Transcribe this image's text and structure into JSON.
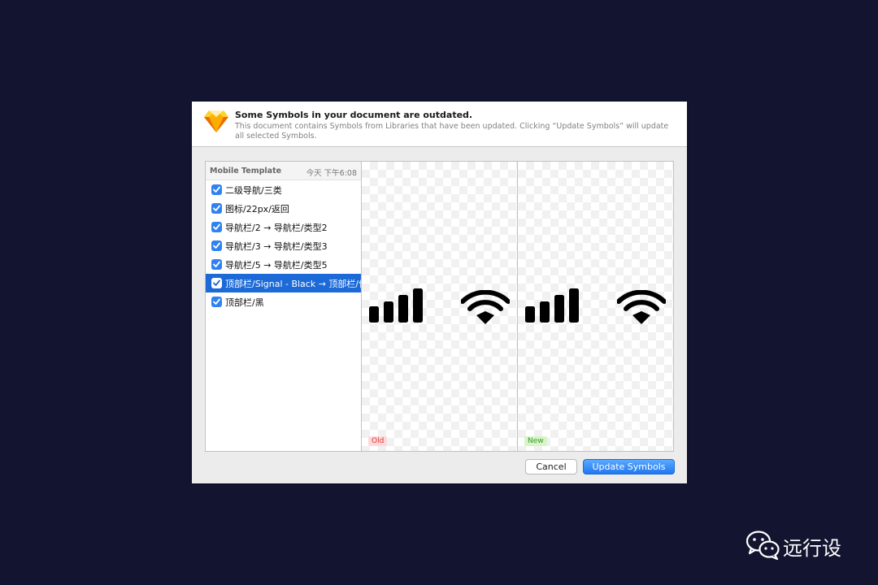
{
  "dialog": {
    "title": "Some Symbols in your document are outdated.",
    "subtitle": "This document contains Symbols from Libraries that have been updated. Clicking “Update Symbols” will update all selected Symbols."
  },
  "list": {
    "library_name": "Mobile Template",
    "timestamp": "今天 下午6:08",
    "items": [
      {
        "label": "二级导航/三类",
        "checked": true,
        "selected": false
      },
      {
        "label": "图标/22px/返回",
        "checked": true,
        "selected": false
      },
      {
        "label": "导航栏/2 → 导航栏/类型2",
        "checked": true,
        "selected": false
      },
      {
        "label": "导航栏/3 → 导航栏/类型3",
        "checked": true,
        "selected": false
      },
      {
        "label": "导航栏/5 → 导航栏/类型5",
        "checked": true,
        "selected": false
      },
      {
        "label": "顶部栏/Signal - Black → 顶部栏/信号",
        "checked": true,
        "selected": true
      },
      {
        "label": "顶部栏/黑",
        "checked": true,
        "selected": false
      }
    ]
  },
  "preview": {
    "old_label": "Old",
    "new_label": "New",
    "icons": [
      "signal-bars-icon",
      "wifi-icon"
    ]
  },
  "buttons": {
    "cancel": "Cancel",
    "update": "Update Symbols"
  },
  "watermark": {
    "text": "远行设",
    "icon": "wechat-icon"
  },
  "colors": {
    "background": "#121430",
    "accent": "#1b6ad8",
    "button_primary": "#2f82f1"
  }
}
